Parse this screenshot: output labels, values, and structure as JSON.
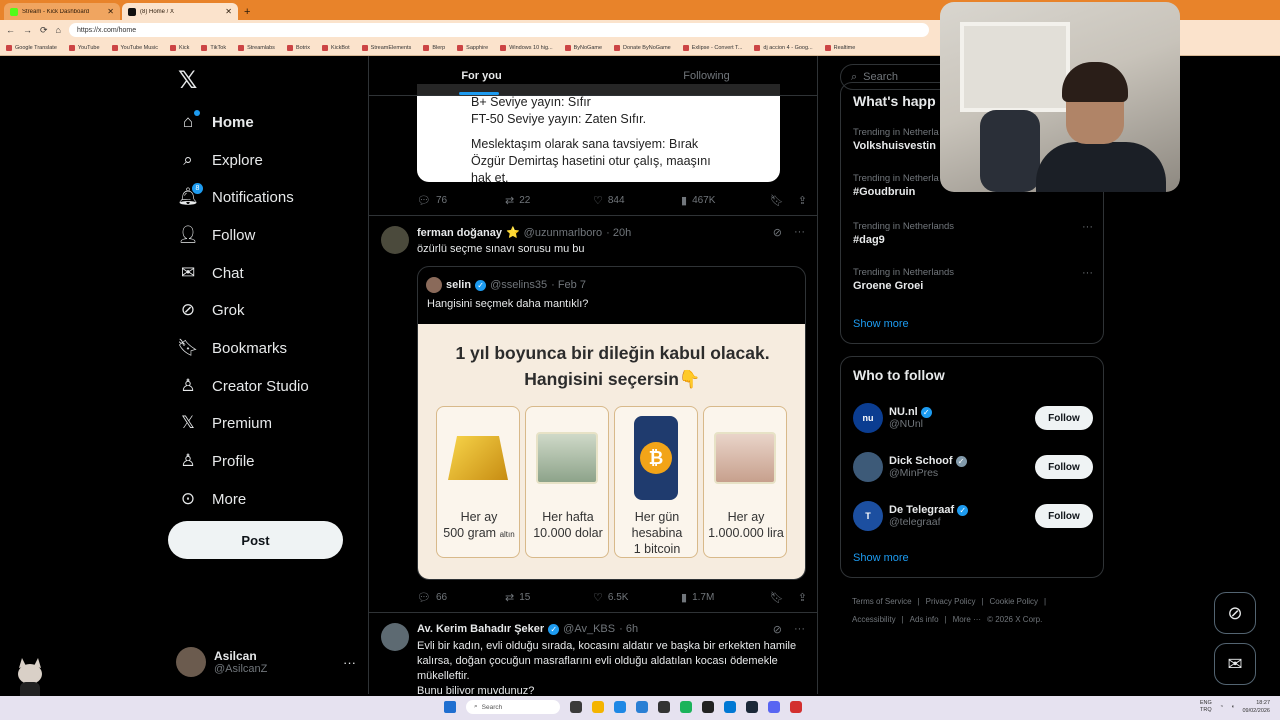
{
  "browser": {
    "tabs": [
      {
        "title": "Stream - Kick Dashboard",
        "active": false
      },
      {
        "title": "(8) Home / X",
        "active": true
      }
    ],
    "url": "https://x.com/home",
    "bookmarks": [
      "Google Translate",
      "YouTube",
      "YouTube Music",
      "Kick",
      "TikTok",
      "Streamlabs",
      "Botrix",
      "KickBot",
      "StreamElements",
      "Blerp",
      "Sapphire",
      "Windows 10 hig...",
      "ByNoGame",
      "Donate ByNoGame",
      "Exlipse - Convert T...",
      "dj accion 4 - Goog...",
      "Realtime"
    ]
  },
  "sidebar": {
    "items": [
      {
        "label": "Home",
        "icon": "home-icon",
        "bold": true
      },
      {
        "label": "Explore",
        "icon": "search-icon"
      },
      {
        "label": "Notifications",
        "icon": "bell-icon",
        "badge": "8"
      },
      {
        "label": "Follow",
        "icon": "person-add-icon"
      },
      {
        "label": "Chat",
        "icon": "mail-icon"
      },
      {
        "label": "Grok",
        "icon": "grok-icon"
      },
      {
        "label": "Bookmarks",
        "icon": "bookmark-icon"
      },
      {
        "label": "Creator Studio",
        "icon": "creator-icon"
      },
      {
        "label": "Premium",
        "icon": "x-logo-icon"
      },
      {
        "label": "Profile",
        "icon": "person-icon"
      },
      {
        "label": "More",
        "icon": "more-circle-icon"
      }
    ],
    "post_label": "Post",
    "account": {
      "name": "Asilcan",
      "handle": "@AsilcanZ"
    }
  },
  "feed": {
    "tabs": [
      "For you",
      "Following"
    ],
    "top_card_lines": [
      "B+ Seviye yayın: Sıfır",
      "FT-50 Seviye yayın: Zaten Sıfır.",
      "Meslektaşım olarak sana tavsiyem: Bırak Özgür Demirtaş hasetini otur çalış, maaşını hak et."
    ],
    "top_actions": {
      "replies": "76",
      "reposts": "22",
      "likes": "844",
      "views": "467K"
    },
    "tweet1": {
      "name": "ferman doğanay",
      "emoji": "⭐",
      "handle": "@uzunmarlboro",
      "time": "· 20h",
      "text": "özürlü seçme sınavı sorusu mu bu",
      "quote": {
        "name": "selin",
        "handle": "@sselins35",
        "time": "· Feb 7",
        "text": "Hangisini seçmek daha mantıklı?",
        "image_title_1": "1 yıl boyunca bir dileğin kabul olacak.",
        "image_title_2": "Hangisini seçersin👇",
        "options": [
          {
            "line1": "Her ay",
            "line2": "500 gram",
            "line3": "altın"
          },
          {
            "line1": "Her hafta",
            "line2": "10.000 dolar",
            "line3": ""
          },
          {
            "line1": "Her gün",
            "line2": "hesabina",
            "line3": "1 bitcoin"
          },
          {
            "line1": "Her ay",
            "line2": "1.000.000 lira",
            "line3": ""
          }
        ]
      },
      "actions": {
        "replies": "66",
        "reposts": "15",
        "likes": "6.5K",
        "views": "1.7M"
      }
    },
    "tweet2": {
      "name": "Av. Kerim Bahadır Şeker",
      "handle": "@Av_KBS",
      "time": "· 6h",
      "text": "Evli bir kadın, evli olduğu sırada, kocasını aldatır ve başka bir erkekten hamile kalırsa, doğan çocuğun masraflarını evli olduğu aldatılan kocası ödemekle mükelleftir.",
      "text2": "Bunu biliyor muydunuz?"
    }
  },
  "right": {
    "search_placeholder": "Search",
    "happening_title": "What's happ",
    "trends": [
      {
        "context": "Trending in Netherla",
        "name": "Volkshuisvestin"
      },
      {
        "context": "Trending in Netherla",
        "name": "#Goudbruin"
      },
      {
        "context": "Trending in Netherlands",
        "name": "#dag9"
      },
      {
        "context": "Trending in Netherlands",
        "name": "Groene Groei"
      }
    ],
    "show_more": "Show more",
    "who_title": "Who to follow",
    "who": [
      {
        "name": "NU.nl",
        "handle": "@NUnl",
        "badge": "blue",
        "avatar_text": "nu"
      },
      {
        "name": "Dick Schoof",
        "handle": "@MinPres",
        "badge": "gray",
        "avatar_text": ""
      },
      {
        "name": "De Telegraaf",
        "handle": "@telegraaf",
        "badge": "blue",
        "avatar_text": "T"
      }
    ],
    "follow_label": "Follow",
    "footer": [
      "Terms of Service",
      "|",
      "Privacy Policy",
      "|",
      "Cookie Policy",
      "|",
      "Accessibility",
      "|",
      "Ads info",
      "|",
      "More ···",
      "© 2026 X Corp."
    ]
  },
  "taskbar": {
    "search": "Search",
    "lang": "ENG",
    "lang2": "TRQ",
    "time": "18:27",
    "date": "09/02/2026"
  },
  "colors": {
    "accent": "#1d9bf0",
    "bg": "#000000",
    "border": "#2f3336",
    "muted": "#71767b"
  }
}
